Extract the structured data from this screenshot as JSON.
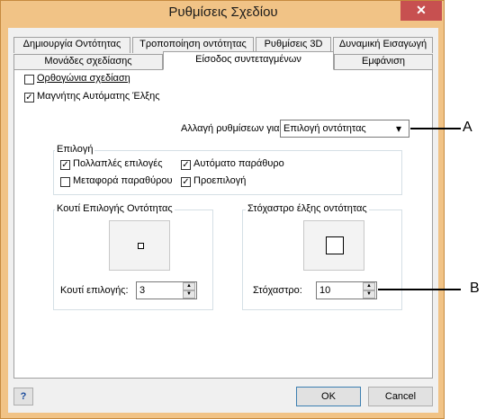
{
  "window": {
    "title": "Ρυθμίσεις Σχεδίου",
    "close_glyph": "✕",
    "frame_color": "#f1c386",
    "close_color": "#c75050"
  },
  "tabs": {
    "row1": [
      "Δημιουργία Οντότητας",
      "Τροποποίηση οντότητας",
      "Ρυθμίσεις 3D",
      "Δυναμική Εισαγωγή"
    ],
    "row2": [
      "Μονάδες σχεδίασης",
      "Είσοδος συντεταγμένων",
      "Εμφάνιση"
    ],
    "active": "Είσοδος συντεταγμένων"
  },
  "options": {
    "ortho": {
      "label": "Ορθογώνια σχεδίαση",
      "checked": false
    },
    "magnet": {
      "label": "Μαγνήτης Αυτόματης Έλξης",
      "checked": true
    }
  },
  "change_settings": {
    "label": "Αλλαγή ρυθμίσεων για",
    "value": "Επιλογή οντότητας"
  },
  "selection_group": {
    "title": "Επιλογή",
    "items": [
      {
        "label": "Πολλαπλές επιλογές",
        "checked": true
      },
      {
        "label": "Αυτόματο παράθυρο",
        "checked": true
      },
      {
        "label": "Μεταφορά παραθύρου",
        "checked": false
      },
      {
        "label": "Προεπιλογή",
        "checked": true
      }
    ]
  },
  "entity_box": {
    "title": "Κουτί Επιλογής Οντότητας",
    "field_label": "Κουτί επιλογής:",
    "value": "3"
  },
  "snap_target": {
    "title": "Στόχαστρο έλξης οντότητας",
    "field_label": "Στόχαστρο:",
    "value": "10"
  },
  "buttons": {
    "help": "?",
    "ok": "OK",
    "cancel": "Cancel"
  },
  "callouts": {
    "a": "A",
    "b": "B"
  },
  "icons": {
    "check": "✓",
    "dropdown": "▾",
    "spin_up": "▲",
    "spin_down": "▼"
  }
}
